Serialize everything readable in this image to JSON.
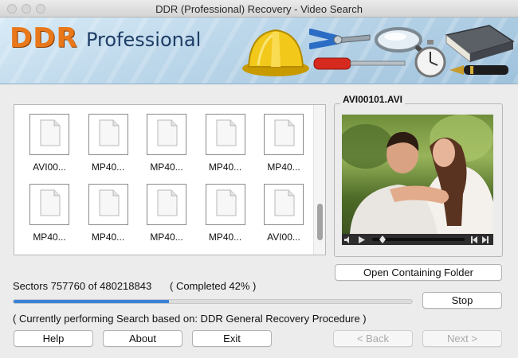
{
  "window": {
    "title": "DDR (Professional) Recovery - Video Search"
  },
  "banner": {
    "brand_primary": "DDR",
    "brand_secondary": "Professional",
    "brand_color": "#e8781a",
    "brand_secondary_color": "#1e3d66"
  },
  "files": [
    {
      "name": "AVI00...",
      "icon": "blank-document-icon"
    },
    {
      "name": "MP40...",
      "icon": "blank-document-icon"
    },
    {
      "name": "MP40...",
      "icon": "blank-document-icon"
    },
    {
      "name": "MP40...",
      "icon": "blank-document-icon"
    },
    {
      "name": "MP40...",
      "icon": "blank-document-icon"
    },
    {
      "name": "MP40...",
      "icon": "blank-document-icon"
    },
    {
      "name": "MP40...",
      "icon": "blank-document-icon"
    },
    {
      "name": "MP40...",
      "icon": "blank-document-icon"
    },
    {
      "name": "MP40...",
      "icon": "blank-document-icon"
    },
    {
      "name": "AVI00...",
      "icon": "blank-document-icon"
    }
  ],
  "preview": {
    "label": "AVI00101.AVI"
  },
  "buttons": {
    "open_folder": "Open Containing Folder",
    "stop": "Stop",
    "help": "Help",
    "about": "About",
    "exit": "Exit",
    "back": "< Back",
    "next": "Next >"
  },
  "status": {
    "sectors": "Sectors 757760 of 480218843",
    "completed": "( Completed 42% )",
    "progress_fraction": 0.39,
    "progress_color": "#3a83db",
    "procedure": "( Currently performing Search based on: DDR General Recovery Procedure )"
  }
}
